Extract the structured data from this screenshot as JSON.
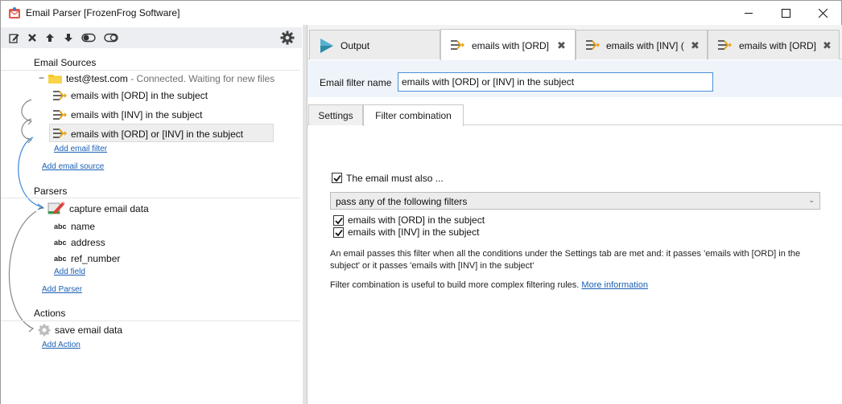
{
  "window": {
    "title": "Email Parser [FrozenFrog Software]"
  },
  "sources_section": {
    "label": "Email Sources",
    "source": {
      "account": "test@test.com",
      "status": " - Connected. Waiting for new files"
    },
    "filters": [
      {
        "label": "emails with [ORD] in the subject"
      },
      {
        "label": "emails with [INV] in the subject"
      },
      {
        "label": "emails with [ORD] or [INV] in the subject"
      }
    ],
    "add_filter_link": "Add email filter",
    "add_source_link": "Add email source"
  },
  "parsers_section": {
    "label": "Parsers",
    "parser": {
      "label": "capture email data"
    },
    "fields": [
      {
        "type_tag": "abc",
        "label": "name"
      },
      {
        "type_tag": "abc",
        "label": "address"
      },
      {
        "type_tag": "abc",
        "label": "ref_number"
      }
    ],
    "add_field_link": "Add field",
    "add_parser_link": "Add Parser"
  },
  "actions_section": {
    "label": "Actions",
    "action": {
      "label": "save email data"
    },
    "add_action_link": "Add Action"
  },
  "tabs": [
    {
      "label": "Output",
      "icon": "play-icon"
    },
    {
      "label": "emails with [ORD]",
      "close": "✖",
      "active": true
    },
    {
      "label": "emails with [INV] (",
      "close": "✖"
    },
    {
      "label": "emails with [ORD]",
      "close": "✖"
    }
  ],
  "filter_editor": {
    "name_label": "Email filter name",
    "name_value": "emails with [ORD] or [INV] in the subject",
    "subtabs": [
      "Settings",
      "Filter combination"
    ],
    "must_also_label": "The email must also ...",
    "must_also_checked": true,
    "mode_value": "pass any of the following filters",
    "mode_arrow": "⌄",
    "filter_options": [
      {
        "label": "emails with [ORD] in the subject",
        "checked": true
      },
      {
        "label": "emails with [INV] in the subject",
        "checked": true
      }
    ],
    "description_1": "An email passes this filter when all the conditions under the Settings tab are met and: it passes 'emails with [ORD] in the subject' or it passes 'emails with [INV] in the subject'",
    "description_2": "Filter combination is useful to build more complex filtering rules.",
    "more_info_link": "More information"
  },
  "colors": {
    "link": "#1a5fb4",
    "accent": "#4a90d9",
    "header_bg": "#eef4fa",
    "toolbar_bg": "#eceef1"
  }
}
